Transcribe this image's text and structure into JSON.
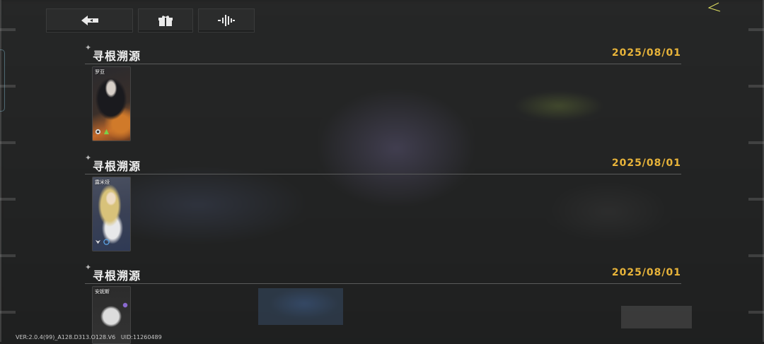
{
  "toolbar": {
    "back": {
      "icon": "back-arrow-icon"
    },
    "gift": {
      "icon": "gift-icon"
    },
    "audio": {
      "icon": "audio-wave-icon"
    }
  },
  "entries": [
    {
      "title": "寻根溯源",
      "date": "2025/08/01",
      "card": {
        "name": "罗亚",
        "palette": [
          "#2a2a2e",
          "#c46a2a",
          "#6b3a1e"
        ],
        "icons": [
          "faction-icon",
          "element-icon"
        ]
      }
    },
    {
      "title": "寻根溯源",
      "date": "2025/08/01",
      "card": {
        "name": "露米娅",
        "palette": [
          "#4a5060",
          "#d8c27a",
          "#2f3a55"
        ],
        "icons": [
          "faction-icon",
          "element-icon"
        ]
      }
    },
    {
      "title": "寻根溯源",
      "date": "2025/08/01",
      "card": {
        "name": "安妮斯",
        "palette": [
          "#2c2c2c",
          "#d9d9d9",
          "#6a5aa0"
        ],
        "icons": []
      }
    }
  ],
  "footer": {
    "version": "VER:2.0.4(99)_A128.D313.O128.V6",
    "uid": "UID:11260489"
  },
  "colors": {
    "accent_date": "#e8b43a",
    "background": "#1e1f1f"
  }
}
